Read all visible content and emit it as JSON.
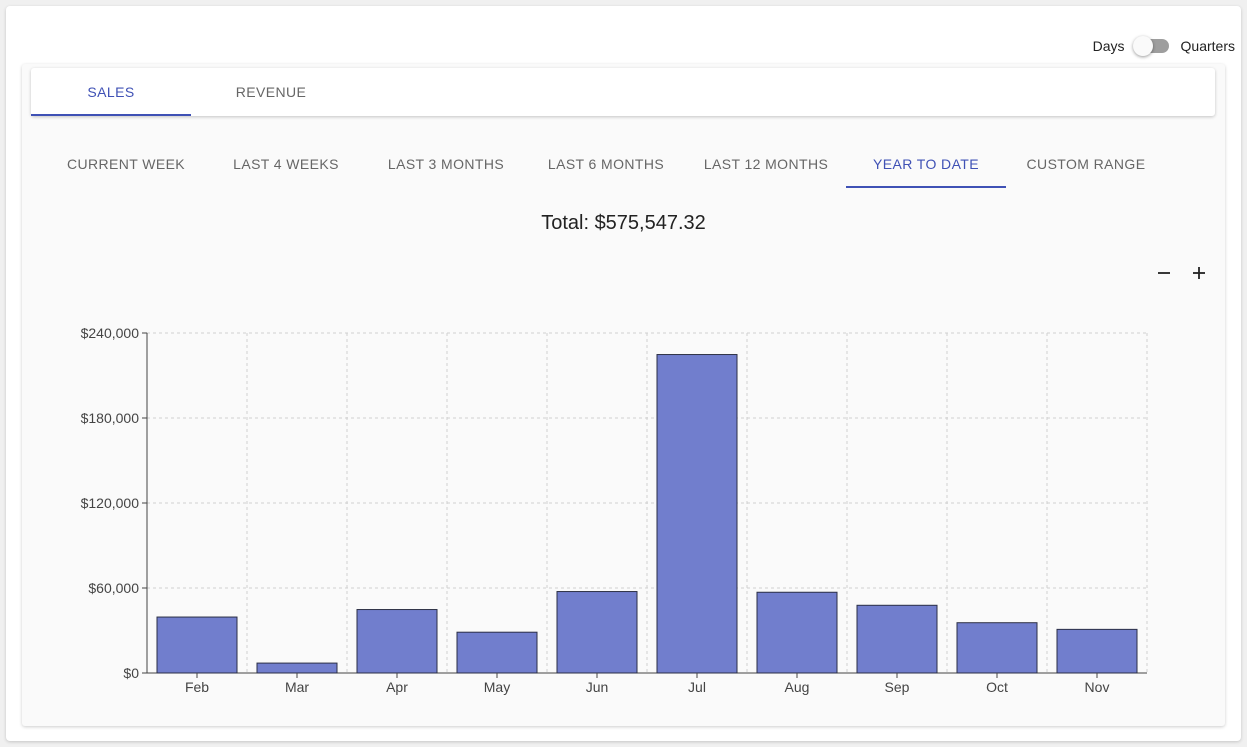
{
  "toggle": {
    "left_label": "Days",
    "right_label": "Quarters",
    "state": "Days"
  },
  "main_tabs": [
    {
      "label": "SALES",
      "active": true
    },
    {
      "label": "REVENUE",
      "active": false
    }
  ],
  "range_tabs": [
    {
      "label": "CURRENT WEEK",
      "active": false
    },
    {
      "label": "LAST 4 WEEKS",
      "active": false
    },
    {
      "label": "LAST 3 MONTHS",
      "active": false
    },
    {
      "label": "LAST 6 MONTHS",
      "active": false
    },
    {
      "label": "LAST 12 MONTHS",
      "active": false
    },
    {
      "label": "YEAR TO DATE",
      "active": true
    },
    {
      "label": "CUSTOM RANGE",
      "active": false
    }
  ],
  "total_text": "Total: $575,547.32",
  "zoom": {
    "out_icon": "minus-icon",
    "in_icon": "plus-icon"
  },
  "colors": {
    "accent": "#3f51b5",
    "bar": "#717ecd",
    "bar_stroke": "#2b2f45"
  },
  "chart_data": {
    "type": "bar",
    "categories": [
      "Feb",
      "Mar",
      "Apr",
      "May",
      "Jun",
      "Jul",
      "Aug",
      "Sep",
      "Oct",
      "Nov"
    ],
    "values": [
      39500,
      7000,
      44800,
      28800,
      57500,
      224800,
      57000,
      47800,
      35500,
      30800
    ],
    "ylim": [
      0,
      240000
    ],
    "yticks": [
      0,
      60000,
      120000,
      180000,
      240000
    ],
    "ytick_labels": [
      "$0",
      "$60,000",
      "$120,000",
      "$180,000",
      "$240,000"
    ],
    "grid": true
  }
}
